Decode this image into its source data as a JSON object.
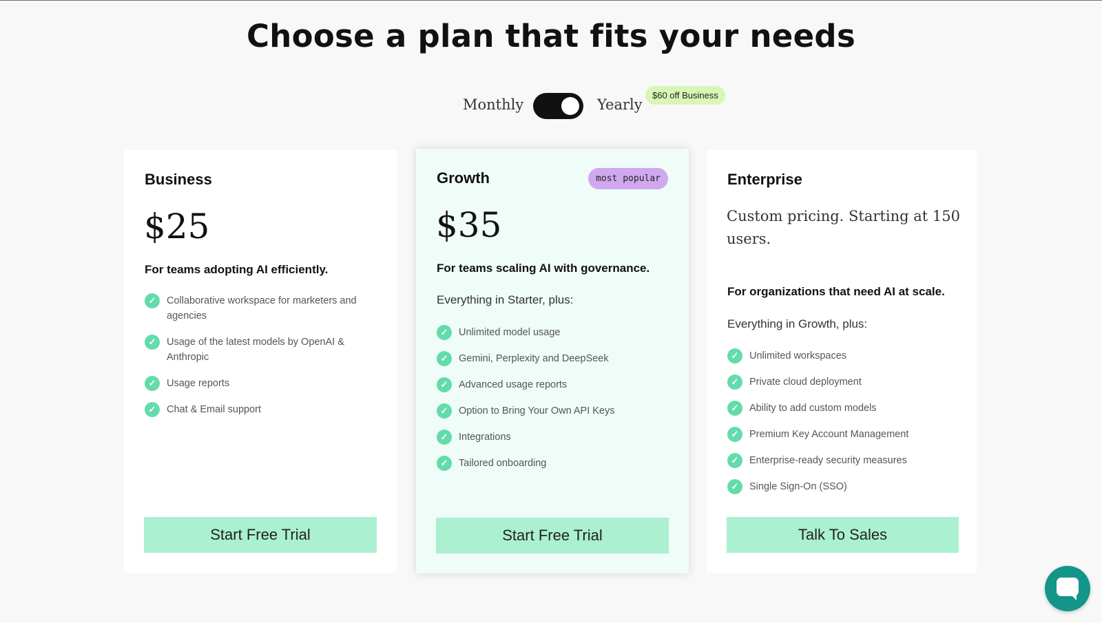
{
  "page": {
    "title": "Choose a plan that fits your needs"
  },
  "billing": {
    "monthly_label": "Monthly",
    "yearly_label": "Yearly",
    "selected": "Yearly",
    "discount_badge": "$60 off Business"
  },
  "plans": [
    {
      "name": "Business",
      "price": "$25",
      "tagline": "For teams adopting AI efficiently.",
      "features": [
        "Collaborative workspace for marketers and agencies",
        "Usage of the latest models by OpenAI & Anthropic",
        "Usage reports",
        "Chat & Email support"
      ],
      "cta": "Start Free Trial"
    },
    {
      "name": "Growth",
      "badge": "most popular",
      "price": "$35",
      "tagline": "For teams scaling AI with governance.",
      "intro": "Everything in Starter, plus:",
      "features": [
        "Unlimited model usage",
        "Gemini, Perplexity and DeepSeek",
        "Advanced usage reports",
        "Option to Bring Your Own API Keys",
        "Integrations",
        "Tailored onboarding"
      ],
      "cta": "Start Free Trial"
    },
    {
      "name": "Enterprise",
      "price_text": "Custom pricing. Starting at 150 users.",
      "tagline": "For organizations that need AI at scale.",
      "intro": "Everything in Growth, plus:",
      "features": [
        "Unlimited workspaces",
        "Private cloud deployment",
        "Ability to add custom models",
        "Premium Key Account Management",
        "Enterprise-ready security measures",
        "Single Sign-On (SSO)"
      ],
      "cta": "Talk To Sales"
    }
  ],
  "colors": {
    "accent": "#64dbab",
    "cta_bg": "#aaf0d1",
    "growth_bg": "#effcf8",
    "badge_bg": "#d0a8f0",
    "discount_bg": "#d9f6b6",
    "chat_bg": "#14958a"
  },
  "icons": {
    "feature": "check-circle-icon",
    "chat": "chat-bubble-icon"
  }
}
